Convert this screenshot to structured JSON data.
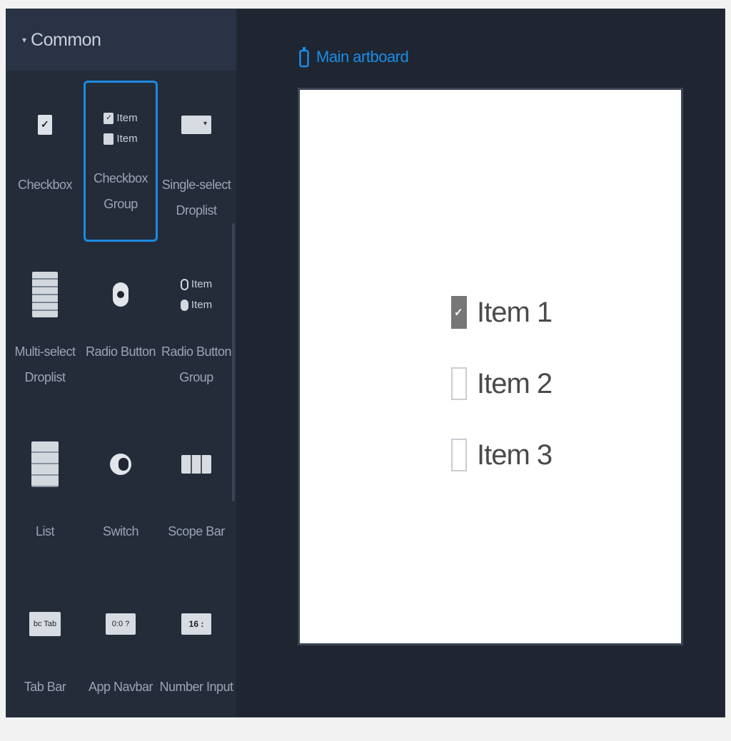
{
  "sidebar": {
    "section_title": "Common",
    "caret_icon": "caret-down-icon",
    "tiles": [
      {
        "label": "Checkbox"
      },
      {
        "label": "Checkbox Group",
        "thumb_items": [
          "Item",
          "Item"
        ]
      },
      {
        "label": "Single-select Droplist"
      },
      {
        "label": "Multi-select Droplist"
      },
      {
        "label": "Radio Button"
      },
      {
        "label": "Radio Button Group",
        "thumb_items": [
          "Item",
          "Item"
        ]
      },
      {
        "label": "List"
      },
      {
        "label": "Switch"
      },
      {
        "label": "Scope Bar"
      },
      {
        "label": "Tab Bar",
        "thumb_text": "bc Tab"
      },
      {
        "label": "App Navbar",
        "thumb_text": "0:0 ?"
      },
      {
        "label": "Number Input",
        "thumb_text": "16 :"
      }
    ],
    "selected_index": 1
  },
  "canvas": {
    "artboard_title": "Main artboard",
    "artboard_icon": "phone-icon",
    "accent_color": "#1a8ce6",
    "checkboxes": [
      {
        "label": "Item 1",
        "checked": true
      },
      {
        "label": "Item 2",
        "checked": false
      },
      {
        "label": "Item 3",
        "checked": false
      }
    ]
  }
}
